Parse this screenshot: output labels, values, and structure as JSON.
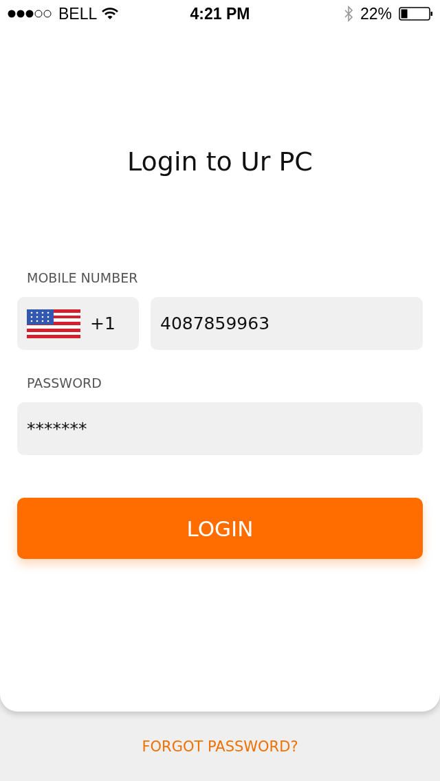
{
  "status_bar": {
    "carrier": "BELL",
    "time": "4:21 PM",
    "battery": "22%"
  },
  "title": "Login to Ur PC",
  "mobile": {
    "label": "MOBILE NUMBER",
    "country_code": "+1",
    "value": "4087859963"
  },
  "password": {
    "label": "PASSWORD",
    "value": "*******"
  },
  "login_button": "LOGIN",
  "forgot_link": "FORGOT PASSWORD?"
}
